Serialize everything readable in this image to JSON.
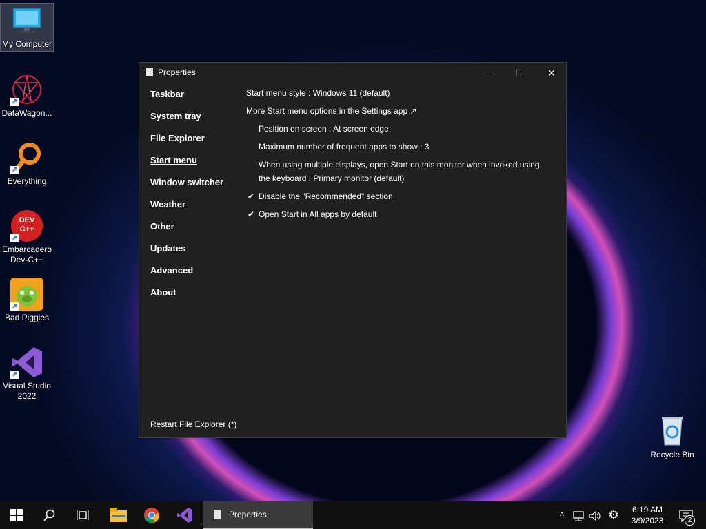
{
  "desktop": {
    "icons": [
      {
        "label": "My Computer",
        "icon": "monitor-icon"
      },
      {
        "label": "DataWagon...",
        "icon": "datawagon-icon"
      },
      {
        "label": "Everything",
        "icon": "search-magnifier-icon"
      },
      {
        "label": "Embarcadero Dev-C++",
        "icon": "devcpp-icon",
        "badge": "DEV C++"
      },
      {
        "label": "Bad Piggies",
        "icon": "bad-piggies-icon"
      },
      {
        "label": "Visual Studio 2022",
        "icon": "visual-studio-icon"
      },
      {
        "label": "Recycle Bin",
        "icon": "recycle-bin-icon"
      }
    ]
  },
  "window": {
    "title": "Properties",
    "controls": {
      "minimize": "—",
      "maximize": "☐",
      "close": "✕"
    },
    "nav": [
      {
        "label": "Taskbar"
      },
      {
        "label": "System tray"
      },
      {
        "label": "File Explorer"
      },
      {
        "label": "Start menu",
        "active": true
      },
      {
        "label": "Window switcher"
      },
      {
        "label": "Weather"
      },
      {
        "label": "Other"
      },
      {
        "label": "Updates"
      },
      {
        "label": "Advanced"
      },
      {
        "label": "About"
      }
    ],
    "settings": [
      {
        "text": "Start menu style : Windows 11 (default)",
        "indent": false,
        "checked": false
      },
      {
        "text": "More Start menu options in the Settings app ↗",
        "indent": false,
        "checked": false
      },
      {
        "text": "Position on screen : At screen edge",
        "indent": true,
        "checked": false
      },
      {
        "text": "Maximum number of frequent apps to show : 3",
        "indent": true,
        "checked": false
      },
      {
        "text": "When using multiple displays, open Start on this monitor when invoked using the keyboard : Primary monitor (default)",
        "indent": true,
        "checked": false
      },
      {
        "text": "Disable the \"Recommended\" section",
        "indent": true,
        "checked": true
      },
      {
        "text": "Open Start in All apps by default",
        "indent": true,
        "checked": true
      }
    ],
    "check_glyph": "✔",
    "footer_link": "Restart File Explorer (*)"
  },
  "taskbar": {
    "start_icon": "windows-logo-icon",
    "search_icon": "search-icon",
    "task_view_icon": "task-view-icon",
    "pinned": [
      "file-explorer-icon",
      "chrome-icon",
      "visual-studio-icon"
    ],
    "open_task": "Properties",
    "tray": {
      "chevron": "^",
      "network_icon": "network-icon",
      "volume_icon": "volume-icon",
      "settings_icon": "gear-icon",
      "time": "6:19 AM",
      "date": "3/9/2023",
      "notifications_count": "2"
    }
  }
}
